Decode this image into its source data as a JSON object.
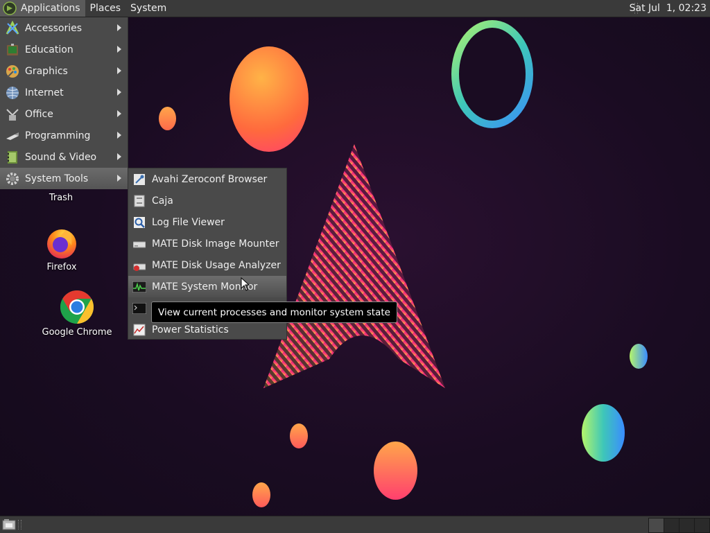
{
  "top_panel": {
    "menus": [
      "Applications",
      "Places",
      "System"
    ],
    "clock": "Sat Jul  1, 02:23"
  },
  "desktop": {
    "icons": [
      {
        "label": "Trash",
        "icon": "trash-icon"
      },
      {
        "label": "Firefox",
        "icon": "firefox-icon"
      },
      {
        "label": "Google Chrome",
        "icon": "chrome-icon"
      }
    ]
  },
  "menu": {
    "items": [
      {
        "label": "Accessories",
        "icon": "accessories-icon"
      },
      {
        "label": "Education",
        "icon": "education-icon"
      },
      {
        "label": "Graphics",
        "icon": "graphics-icon"
      },
      {
        "label": "Internet",
        "icon": "internet-icon"
      },
      {
        "label": "Office",
        "icon": "office-icon"
      },
      {
        "label": "Programming",
        "icon": "programming-icon"
      },
      {
        "label": "Sound & Video",
        "icon": "sound-video-icon"
      },
      {
        "label": "System Tools",
        "icon": "system-tools-icon",
        "active": true
      }
    ]
  },
  "submenu": {
    "items": [
      {
        "label": "Avahi Zeroconf Browser",
        "icon": "avahi-icon"
      },
      {
        "label": "Caja",
        "icon": "caja-icon"
      },
      {
        "label": "Log File Viewer",
        "icon": "log-viewer-icon"
      },
      {
        "label": "MATE Disk Image Mounter",
        "icon": "disk-mounter-icon"
      },
      {
        "label": "MATE Disk Usage Analyzer",
        "icon": "disk-usage-icon"
      },
      {
        "label": "MATE System Monitor",
        "icon": "system-monitor-icon",
        "hover": true
      },
      {
        "label": "",
        "icon": "terminal-icon"
      },
      {
        "label": "Power Statistics",
        "icon": "power-stats-icon"
      }
    ]
  },
  "tooltip": {
    "text": "View current processes and monitor system state"
  },
  "colors": {
    "panel": "#3a3a3a",
    "menu": "#4a4a4a",
    "desktop": "#1a0c22"
  }
}
